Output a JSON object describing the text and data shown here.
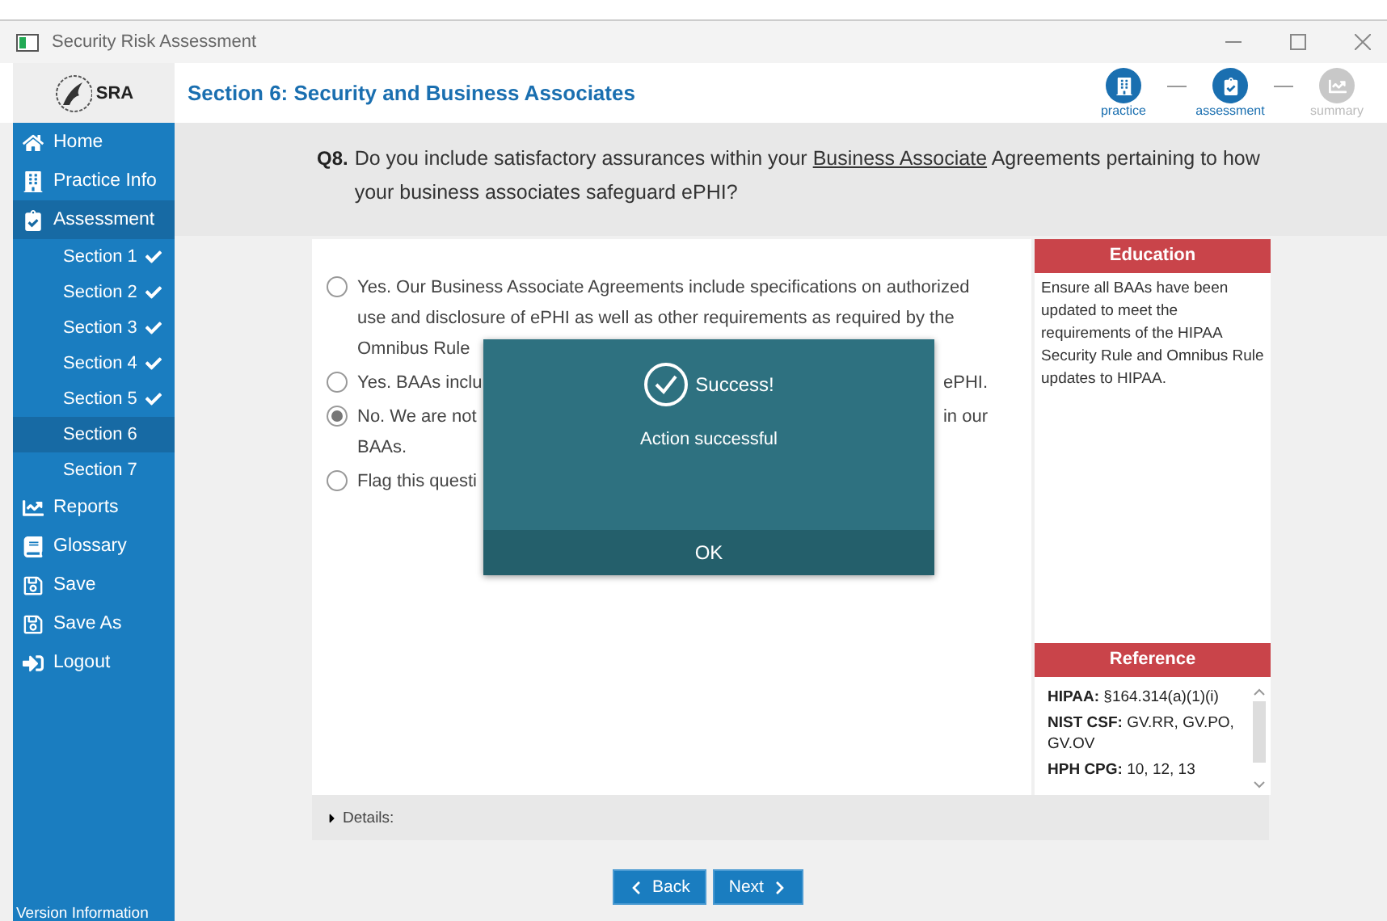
{
  "window": {
    "title": "Security Risk Assessment"
  },
  "logo": {
    "text": "SRA"
  },
  "section_title": "Section 6: Security and Business Associates",
  "steps": [
    {
      "label": "practice",
      "active": true,
      "kind": "practice"
    },
    {
      "label": "assessment",
      "active": true,
      "kind": "assessment"
    },
    {
      "label": "summary",
      "active": false,
      "kind": "summary"
    }
  ],
  "sidebar": {
    "items": [
      {
        "label": "Home",
        "kind": "home",
        "selected": false
      },
      {
        "label": "Practice Info",
        "kind": "practice",
        "selected": false
      },
      {
        "label": "Assessment",
        "kind": "assessment",
        "selected": true,
        "children": [
          {
            "label": "Section 1",
            "done": true,
            "selected": false
          },
          {
            "label": "Section 2",
            "done": true,
            "selected": false
          },
          {
            "label": "Section 3",
            "done": true,
            "selected": false
          },
          {
            "label": "Section 4",
            "done": true,
            "selected": false
          },
          {
            "label": "Section 5",
            "done": true,
            "selected": false
          },
          {
            "label": "Section 6",
            "done": false,
            "selected": true
          },
          {
            "label": "Section 7",
            "done": false,
            "selected": false
          }
        ]
      },
      {
        "label": "Reports",
        "kind": "reports",
        "selected": false
      },
      {
        "label": "Glossary",
        "kind": "glossary",
        "selected": false
      },
      {
        "label": "Save",
        "kind": "save",
        "selected": false
      },
      {
        "label": "Save As",
        "kind": "save",
        "selected": false
      },
      {
        "label": "Logout",
        "kind": "logout",
        "selected": false
      }
    ],
    "footer": "Version Information"
  },
  "question": {
    "number": "Q8.",
    "before": "Do you include satisfactory assurances within your",
    "link": "Business Associate",
    "after": "Agreements pertaining to how your business associates safeguard ePHI?"
  },
  "options": [
    {
      "selected": false,
      "lines": [
        {
          "left": "Yes. Our Business Associate Agreements include specifications on authorized"
        },
        {
          "left": "use and disclosure of ePHI as well as other requirements as required by the"
        },
        {
          "left": "Omnibus Rule"
        }
      ]
    },
    {
      "selected": false,
      "lines": [
        {
          "left": "Yes. BAAs inclu",
          "right": "ePHI."
        }
      ]
    },
    {
      "selected": true,
      "lines": [
        {
          "left": "No. We are not",
          "right": "in our"
        },
        {
          "left": "BAAs."
        }
      ]
    },
    {
      "selected": false,
      "lines": [
        {
          "left": "Flag this questi"
        }
      ]
    }
  ],
  "education": {
    "title": "Education",
    "text": "Ensure all BAAs have been updated to meet the requirements of the HIPAA Security Rule and Omnibus Rule updates to HIPAA."
  },
  "reference": {
    "title": "Reference",
    "items": [
      "**HIPAA:** §164.314(a)(1)(i)",
      "**NIST CSF:** GV.RR, GV.PO, GV.OV",
      "**HPH CPG:** 10, 12, 13"
    ]
  },
  "details": {
    "label": "Details:",
    "expanded": false
  },
  "nav": {
    "back": "Back",
    "next": "Next"
  },
  "dialog": {
    "title": "Success!",
    "message": "Action successful",
    "button": "OK"
  }
}
